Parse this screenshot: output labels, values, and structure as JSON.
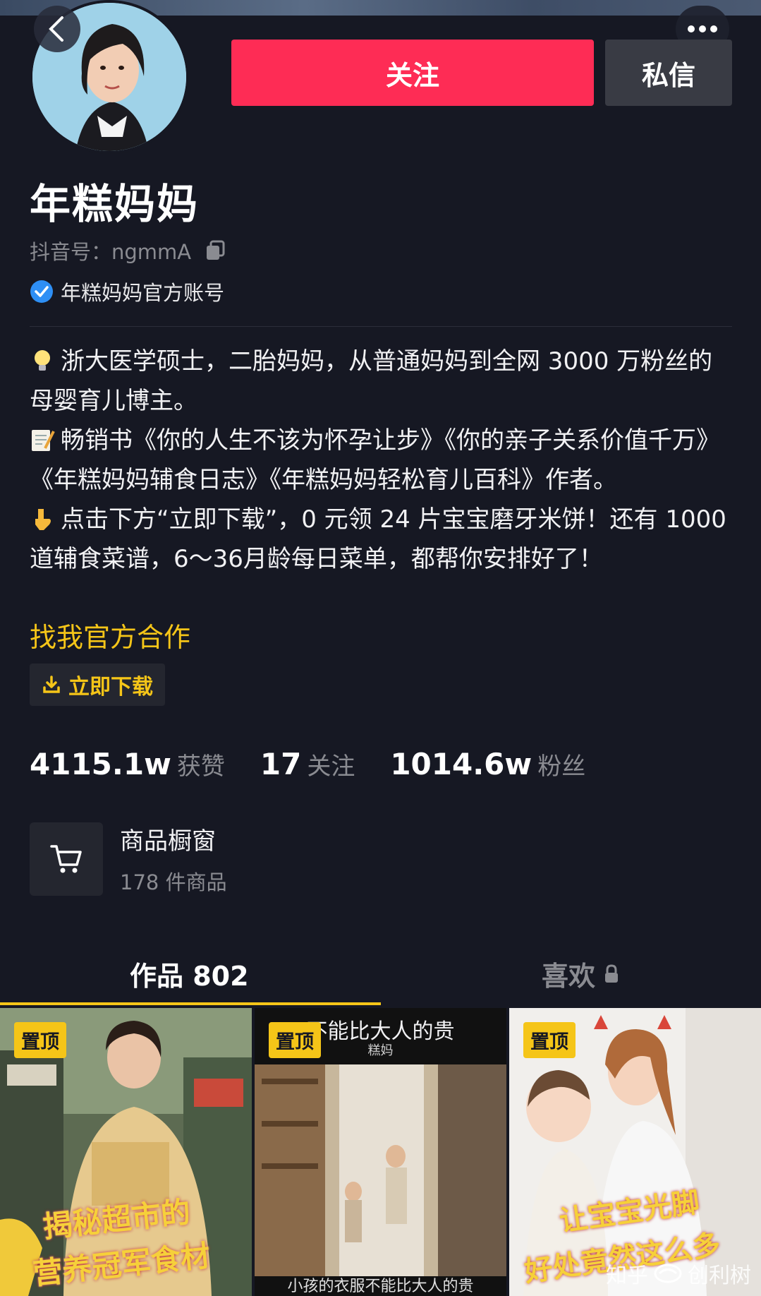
{
  "header": {
    "follow_label": "关注",
    "message_label": "私信"
  },
  "profile": {
    "nickname": "年糕妈妈",
    "id_label": "抖音号：ngmmA",
    "verified_text": "年糕妈妈官方账号",
    "bio": [
      "浙大医学硕士，二胎妈妈，从普通妈妈到全网 3000 万粉丝的母婴育儿博主。",
      "畅销书《你的人生不该为怀孕让步》《你的亲子关系价值千万》《年糕妈妈辅食日志》《年糕妈妈轻松育儿百科》作者。",
      "点击下方“立即下载”，0 元领 24 片宝宝磨牙米饼！还有 1000 道辅食菜谱，6～36月龄每日菜单，都帮你安排好了！"
    ],
    "cooperation_link": "找我官方合作",
    "download_label": "立即下载"
  },
  "stats": {
    "likes_value": "4115.1w",
    "likes_label": "获赞",
    "following_value": "17",
    "following_label": "关注",
    "followers_value": "1014.6w",
    "followers_label": "粉丝"
  },
  "shop": {
    "title": "商品橱窗",
    "count": "178 件商品"
  },
  "tabs": {
    "works_label": "作品 802",
    "likes_label": "喜欢"
  },
  "videos": [
    {
      "pin": "置顶",
      "caption_line1": "揭秘超市的",
      "caption_line2": "营养冠军食材"
    },
    {
      "pin": "置顶",
      "top_caption": "不能比大人的贵",
      "top_sub": "糕妈",
      "bottom_caption": "小孩的衣服不能比大人的贵"
    },
    {
      "pin": "置顶",
      "caption_line1": "让宝宝光脚",
      "caption_line2": "好处竟然这么多"
    }
  ],
  "watermark": {
    "text": "知乎",
    "brand": "创利树"
  },
  "colors": {
    "background": "#161823",
    "follow_red": "#fe2c55",
    "accent_yellow": "#f5c518",
    "muted_gray": "#8a8b91"
  }
}
